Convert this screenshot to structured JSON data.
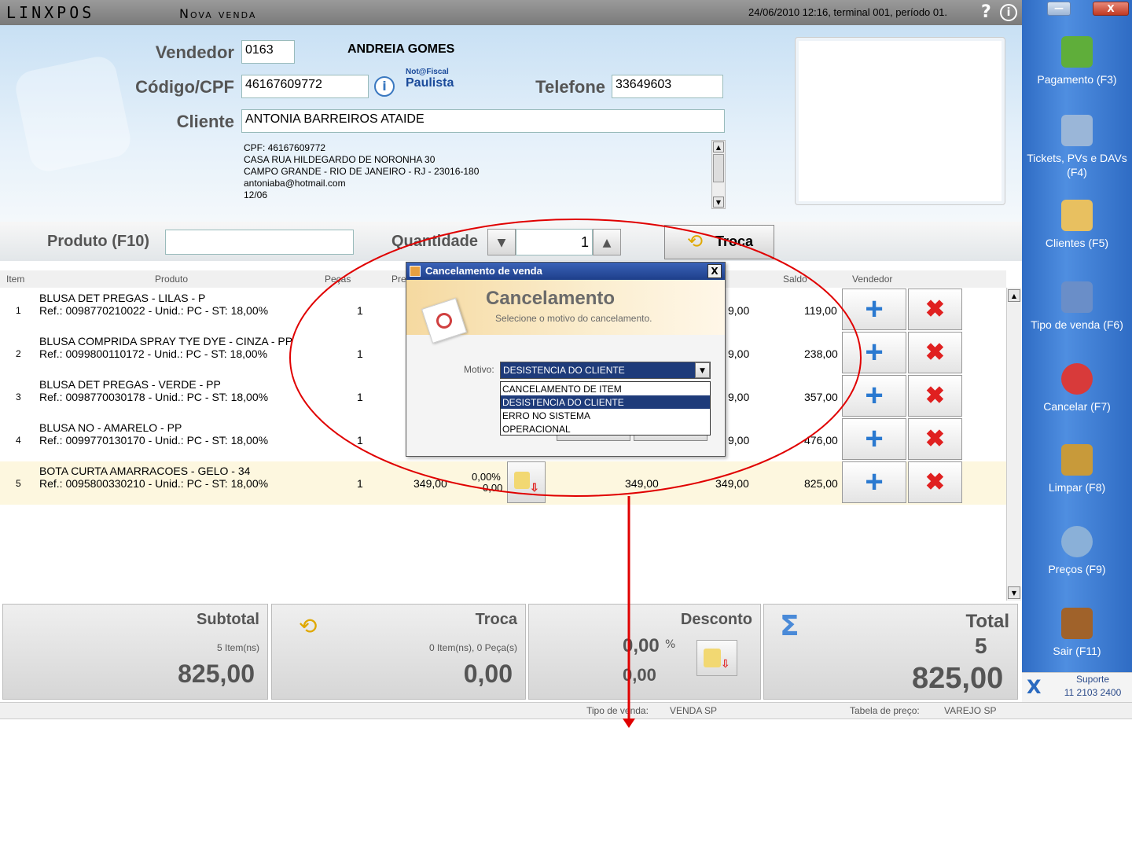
{
  "app": {
    "logo": "LINXPOS",
    "title": "Nova venda",
    "datetime": "24/06/2010 12:16, terminal 001, período 01.",
    "help_icon": "?",
    "info_icon": "i",
    "win_min": "—",
    "win_close": "X"
  },
  "header": {
    "vendedor_label": "Vendedor",
    "vendedor_code": "0163",
    "vendedor_name": "ANDREIA GOMES",
    "cpf_label": "Código/CPF",
    "cpf_value": "46167609772",
    "cpf_info_icon": "i",
    "nfp_line1": "Not@Fiscal",
    "nfp_line2": "Paulista",
    "telefone_label": "Telefone",
    "telefone_value": "33649603",
    "cliente_label": "Cliente",
    "cliente_value": "ANTONIA BARREIROS ATAIDE",
    "client_info": [
      "CPF: 46167609772",
      "CASA RUA HILDEGARDO DE NORONHA 30",
      "CAMPO GRANDE - RIO DE JANEIRO - RJ - 23016-180",
      "antoniaba@hotmail.com",
      "12/06"
    ],
    "scroll_up": "▲",
    "scroll_down": "▼"
  },
  "product": {
    "label": "Produto (F10)",
    "value": "",
    "quantidade_label": "Quantidade",
    "quantidade_value": "1",
    "qty_down": "▼",
    "qty_up": "▲",
    "troca_label": "Troca",
    "troca_icon": "⟲"
  },
  "table": {
    "headers": {
      "item": "Item",
      "produto": "Produto",
      "pecas": "Peças",
      "preco": "Pre",
      "saldo": "Saldo",
      "vendedor": "Vendedor"
    },
    "rows": [
      {
        "idx": "1",
        "name": "BLUSA DET PREGAS - LILAS - P",
        "ref": "Ref.: 0098770210022 - Unid.: PC - ST: 18,00%",
        "qty": "1",
        "partial": "9,00",
        "saldo": "119,00"
      },
      {
        "idx": "2",
        "name": "BLUSA COMPRIDA SPRAY TYE DYE - CINZA - PP",
        "ref": "Ref.: 0099800110172 - Unid.: PC - ST: 18,00%",
        "qty": "1",
        "partial": "9,00",
        "saldo": "238,00"
      },
      {
        "idx": "3",
        "name": "BLUSA DET PREGAS - VERDE - PP",
        "ref": "Ref.: 0098770030178 - Unid.: PC - ST: 18,00%",
        "qty": "1",
        "partial": "9,00",
        "saldo": "357,00"
      },
      {
        "idx": "4",
        "name": "BLUSA NO - AMARELO - PP",
        "ref": "Ref.: 0099770130170 - Unid.: PC - ST: 18,00%",
        "qty": "1",
        "partial": "9,00",
        "saldo": "476,00"
      },
      {
        "idx": "5",
        "name": "BOTA CURTA AMARRACOES - GELO - 34",
        "ref": "Ref.: 0095800330210 - Unid.: PC - ST: 18,00%",
        "qty": "1",
        "price": "349,00",
        "disc_pct": "0,00%",
        "disc_val": "0,00",
        "unit": "349,00",
        "partial": "349,00",
        "saldo": "825,00"
      }
    ],
    "plus_icon": "+",
    "delete_icon": "✖",
    "scroll_up": "▲",
    "scroll_down": "▼"
  },
  "totals": {
    "subtotal_label": "Subtotal",
    "subtotal_items": "5 Item(ns)",
    "subtotal_value": "825,00",
    "troca_label": "Troca",
    "troca_icon": "⟲",
    "troca_items": "0 Item(ns), 0 Peça(s)",
    "troca_value": "0,00",
    "desconto_label": "Desconto",
    "desconto_pct": "0,00",
    "desconto_pct_symbol": "%",
    "desconto_value": "0,00",
    "total_label": "Total",
    "total_icon": "Σ",
    "total_count": "5",
    "total_value": "825,00"
  },
  "status": {
    "tipo_label": "Tipo de venda:",
    "tipo_value": "VENDA SP",
    "tabela_label": "Tabela de preço:",
    "tabela_value": "VAREJO SP"
  },
  "sidebar": {
    "items": [
      {
        "label": "Pagamento (F3)",
        "icon": "money-icon",
        "color": "#5fae3a"
      },
      {
        "label": "Tickets, PVs e DAVs (F4)",
        "icon": "tickets-icon",
        "color": "#9ab6d8"
      },
      {
        "label": "Clientes (F5)",
        "icon": "clients-icon",
        "color": "#e8c060"
      },
      {
        "label": "Tipo de venda (F6)",
        "icon": "shopping-bag-icon",
        "color": "#6a8ec8"
      },
      {
        "label": "Cancelar (F7)",
        "icon": "cancel-icon",
        "color": "#d83a3a"
      },
      {
        "label": "Limpar (F8)",
        "icon": "broom-icon",
        "color": "#c89a3a"
      },
      {
        "label": "Preços (F9)",
        "icon": "magnifier-icon",
        "color": "#8ab0d8"
      },
      {
        "label": "Sair (F11)",
        "icon": "exit-door-icon",
        "color": "#a0622a"
      }
    ],
    "support_label": "Suporte",
    "support_phone": "11 2103 2400",
    "support_logo": "X"
  },
  "dialog": {
    "title": "Cancelamento de venda",
    "close": "X",
    "heading": "Cancelamento",
    "subheading": "Selecione o motivo do cancelamento.",
    "motivo_label": "Motivo:",
    "selected": "DESISTENCIA DO CLIENTE",
    "arrow": "▼",
    "options": [
      "CANCELAMENTO DE ITEM",
      "DESISTENCIA DO CLIENTE",
      "ERRO NO SISTEMA",
      "OPERACIONAL"
    ]
  },
  "colors": {
    "accent_blue": "#1e3b7a",
    "annotation_red": "#e00000",
    "sidebar_blue": "#2f6cc4"
  }
}
